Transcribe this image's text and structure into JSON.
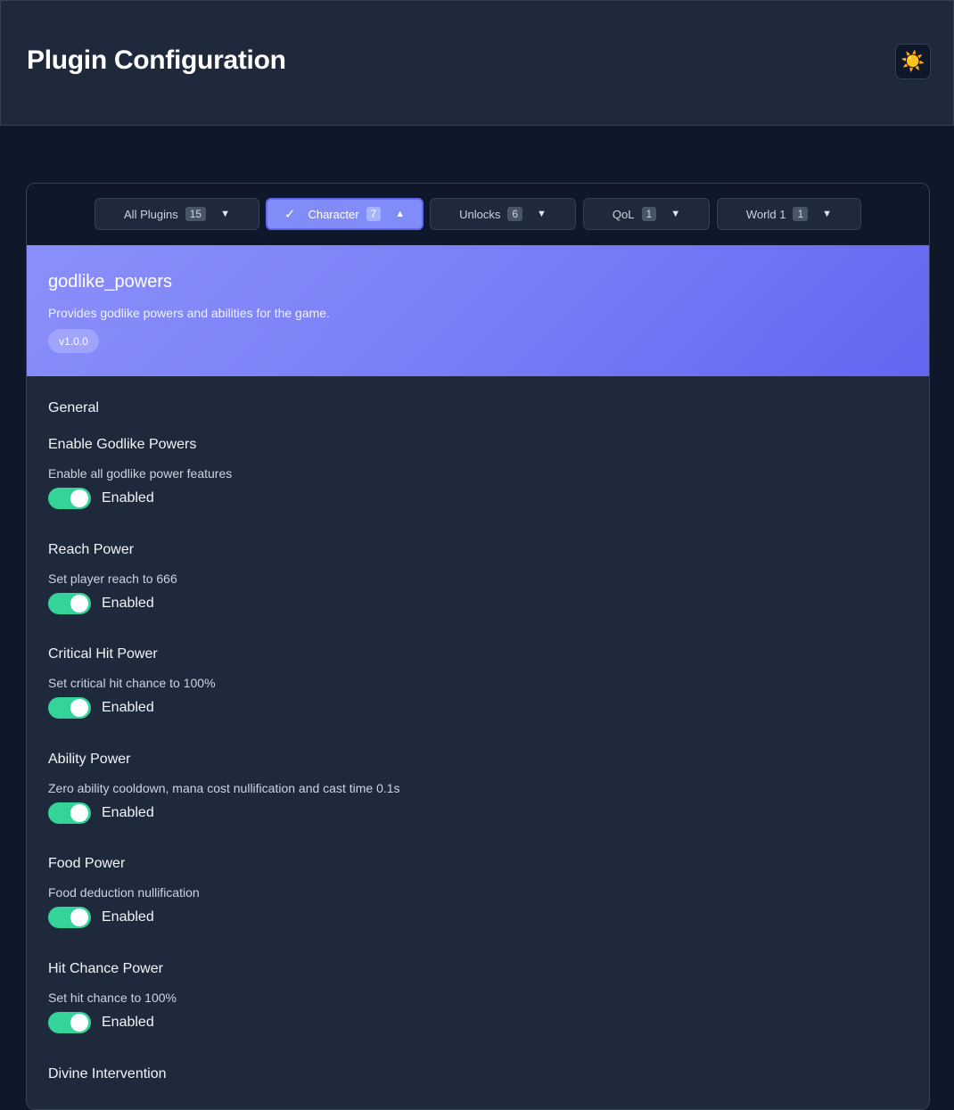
{
  "header": {
    "title": "Plugin Configuration",
    "theme_icon": "☀️"
  },
  "tabs": [
    {
      "label": "All Plugins",
      "count": "15",
      "chevron": "▼",
      "active": false
    },
    {
      "label": "Character",
      "count": "7",
      "chevron": "▲",
      "active": true,
      "check": "✓"
    },
    {
      "label": "Unlocks",
      "count": "6",
      "chevron": "▼",
      "active": false
    },
    {
      "label": "QoL",
      "count": "1",
      "chevron": "▼",
      "active": false
    },
    {
      "label": "World 1",
      "count": "1",
      "chevron": "▼",
      "active": false
    }
  ],
  "plugin": {
    "name": "godlike_powers",
    "description": "Provides godlike powers and abilities for the game.",
    "version": "v1.0.0"
  },
  "section": {
    "title": "General"
  },
  "settings": [
    {
      "name": "Enable Godlike Powers",
      "description": "Enable all godlike power features",
      "state": "Enabled"
    },
    {
      "name": "Reach Power",
      "description": "Set player reach to 666",
      "state": "Enabled"
    },
    {
      "name": "Critical Hit Power",
      "description": "Set critical hit chance to 100%",
      "state": "Enabled"
    },
    {
      "name": "Ability Power",
      "description": "Zero ability cooldown, mana cost nullification and cast time 0.1s",
      "state": "Enabled"
    },
    {
      "name": "Food Power",
      "description": "Food deduction nullification",
      "state": "Enabled"
    },
    {
      "name": "Hit Chance Power",
      "description": "Set hit chance to 100%",
      "state": "Enabled"
    },
    {
      "name": "Divine Intervention",
      "description": "",
      "state": ""
    }
  ],
  "colors": {
    "accent": "#6366f1",
    "toggle_on": "#34d399",
    "background": "#0f172a",
    "panel": "#1e293b"
  }
}
